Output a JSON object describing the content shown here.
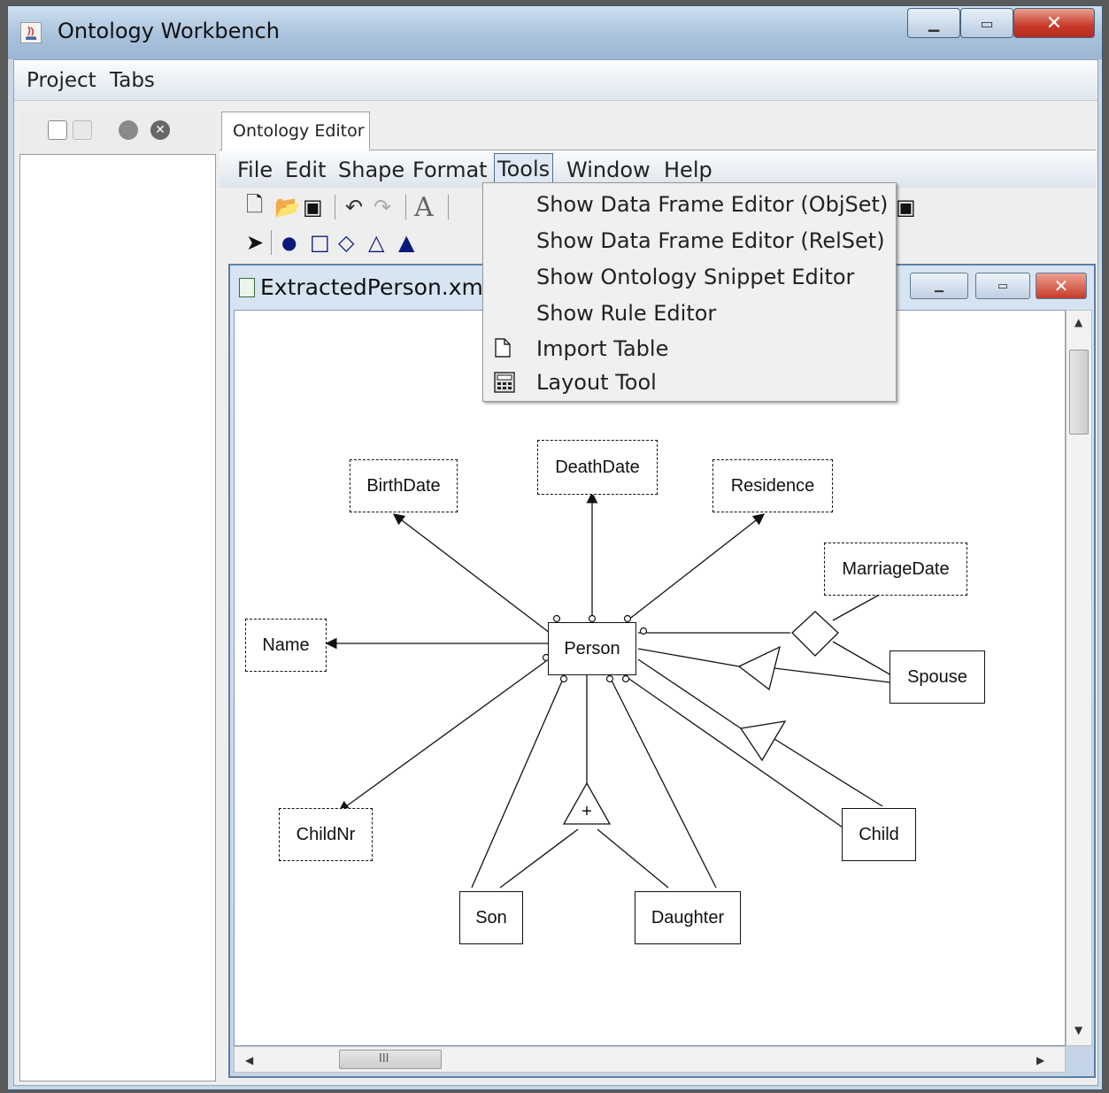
{
  "window": {
    "title": "Ontology Workbench"
  },
  "menubar": {
    "items": [
      "Project",
      "Tabs"
    ]
  },
  "tab": {
    "label": "Ontology Editor"
  },
  "editor_menu": {
    "items": [
      "File",
      "Edit",
      "Shape",
      "Format",
      "Tools",
      "Window",
      "Help"
    ]
  },
  "tools_menu": {
    "items": [
      {
        "label": "Show Data Frame Editor (ObjSet)",
        "icon": ""
      },
      {
        "label": "Show Data Frame Editor (RelSet)",
        "icon": ""
      },
      {
        "label": "Show Ontology Snippet Editor",
        "icon": ""
      },
      {
        "label": "Show Rule Editor",
        "icon": ""
      },
      {
        "label": "Import Table",
        "icon": "new-file-icon"
      },
      {
        "label": "Layout Tool",
        "icon": "layout-tool-icon"
      }
    ]
  },
  "document": {
    "title": "ExtractedPerson.xml"
  },
  "diagram": {
    "nodes": {
      "birthdate": "BirthDate",
      "deathdate": "DeathDate",
      "residence": "Residence",
      "marriagedate": "MarriageDate",
      "name": "Name",
      "person": "Person",
      "spouse": "Spouse",
      "childnr": "ChildNr",
      "child": "Child",
      "son": "Son",
      "daughter": "Daughter"
    },
    "union_symbol": "+"
  },
  "scrollbar": {
    "grip": "III"
  }
}
